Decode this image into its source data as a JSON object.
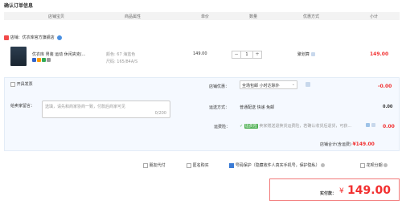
{
  "page": {
    "title": "确认订单信息"
  },
  "header": {
    "columns": [
      "店铺宝贝",
      "商品属性",
      "单价",
      "数量",
      "优惠方式",
      "小计"
    ]
  },
  "store": {
    "label": "店铺：",
    "name": "优衣库官方旗舰店",
    "icons": [
      "store-icon",
      "info-icon"
    ]
  },
  "item": {
    "title": "优衣库 男装 运动 休闲夹克(... ",
    "attr_color": "颜色: 67 海蓝色",
    "attr_size": "尺码: 165/84A/S",
    "price": "149.00",
    "qty": "1",
    "qty_minus": "−",
    "qty_plus": "+",
    "promo": "聚划算",
    "subtotal": "149.00",
    "badges": [
      "#3366cc",
      "#ff9900",
      "#33aa55",
      "#999999"
    ]
  },
  "invoice": {
    "label": "开具发票"
  },
  "discount": {
    "label": "店铺优惠：",
    "value": "全场包邮 小时达除外",
    "amount": "-0.00"
  },
  "message": {
    "label": "给卖家留言：",
    "placeholder": "选填，请先和商家协商一致，付款后商家可见",
    "counter": "0/200"
  },
  "shipping": {
    "label": "运送方式：",
    "value": "普通配送 快递 免邮",
    "amount": "0.00"
  },
  "insurance": {
    "label": "运费险：",
    "tag": "运费险",
    "text": "卖家赠送退换货运费险，若确认收货后退货，可获...",
    "amount": "0.00"
  },
  "store_total": {
    "label": "店铺合计(含运费)",
    "amount": "¥149.00"
  },
  "options": [
    {
      "label": "朋友代付",
      "checked": false
    },
    {
      "label": "匿名购买",
      "checked": false
    },
    {
      "label": "号码保护（隐藏收件人真实手机号，保护隐私）",
      "checked": true
    },
    {
      "label": "花呗分期",
      "checked": false
    }
  ],
  "payment": {
    "label": "实付款：",
    "currency": "¥",
    "amount": "149.00"
  }
}
